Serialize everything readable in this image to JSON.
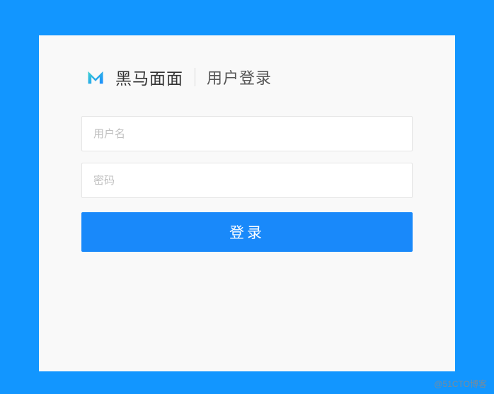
{
  "header": {
    "brand_name": "黑马面面",
    "page_title": "用户登录"
  },
  "form": {
    "username": {
      "placeholder": "用户名",
      "value": ""
    },
    "password": {
      "placeholder": "密码",
      "value": ""
    },
    "submit_label": "登录"
  },
  "watermark": "@51CTO博客",
  "colors": {
    "background": "#1296ff",
    "card": "#f9f9f9",
    "button": "#1989fa",
    "logo_start": "#3ed2d0",
    "logo_end": "#1a8cff"
  }
}
